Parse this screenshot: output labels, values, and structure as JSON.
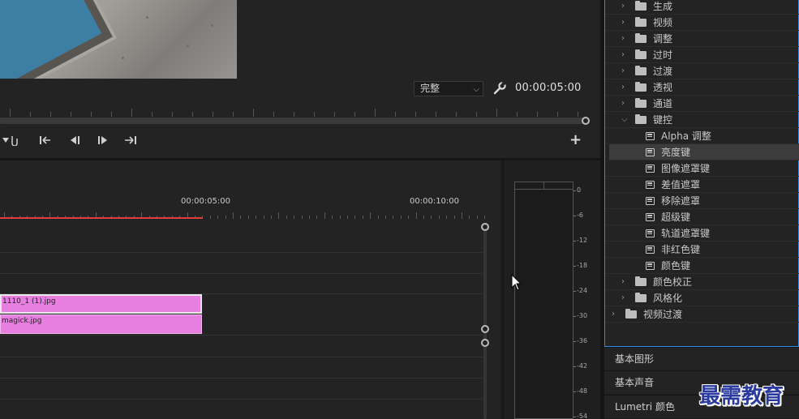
{
  "program_monitor": {
    "fit_select": "完整",
    "timecode": "00:00:05:00"
  },
  "timeline": {
    "ruler_labels": [
      "00:00:05:00",
      "00:00:10:00"
    ],
    "clips": [
      {
        "name": "1110_1 (1).jpg",
        "color": "#e67fe0"
      },
      {
        "name": "magick.jpg",
        "color": "#e67fe0"
      }
    ],
    "playhead_color": "#e53a3a"
  },
  "audio_meter": {
    "db_labels": [
      "0",
      "-6",
      "-12",
      "-18",
      "-24",
      "-30",
      "-36",
      "-42",
      "-48",
      "-54"
    ]
  },
  "effects_tree": {
    "items": [
      {
        "label": "生成",
        "type": "folder",
        "level": 1,
        "expanded": false
      },
      {
        "label": "视频",
        "type": "folder",
        "level": 1,
        "expanded": false
      },
      {
        "label": "调整",
        "type": "folder",
        "level": 1,
        "expanded": false
      },
      {
        "label": "过时",
        "type": "folder",
        "level": 1,
        "expanded": false
      },
      {
        "label": "过渡",
        "type": "folder",
        "level": 1,
        "expanded": false
      },
      {
        "label": "透视",
        "type": "folder",
        "level": 1,
        "expanded": false
      },
      {
        "label": "通道",
        "type": "folder",
        "level": 1,
        "expanded": false
      },
      {
        "label": "键控",
        "type": "folder",
        "level": 1,
        "expanded": true
      },
      {
        "label": "Alpha 调整",
        "type": "effect",
        "level": 2
      },
      {
        "label": "亮度键",
        "type": "effect",
        "level": 2,
        "selected": true
      },
      {
        "label": "图像遮罩键",
        "type": "effect",
        "level": 2
      },
      {
        "label": "差值遮罩",
        "type": "effect",
        "level": 2
      },
      {
        "label": "移除遮罩",
        "type": "effect",
        "level": 2
      },
      {
        "label": "超级键",
        "type": "effect",
        "level": 2
      },
      {
        "label": "轨道遮罩键",
        "type": "effect",
        "level": 2
      },
      {
        "label": "非红色键",
        "type": "effect",
        "level": 2
      },
      {
        "label": "颜色键",
        "type": "effect",
        "level": 2
      },
      {
        "label": "颜色校正",
        "type": "folder",
        "level": 1,
        "expanded": false
      },
      {
        "label": "风格化",
        "type": "folder",
        "level": 1,
        "expanded": false
      },
      {
        "label": "视频过渡",
        "type": "folder",
        "level": 0,
        "expanded": false
      }
    ]
  },
  "panels": {
    "essential_graphics": "基本图形",
    "essential_sound": "基本声音",
    "lumetri_color": "Lumetri 颜色"
  },
  "watermark": "最需教育",
  "colors": {
    "accent_border": "#2d8ceb",
    "clip": "#e67fe0",
    "background": "#1d1d1d"
  }
}
